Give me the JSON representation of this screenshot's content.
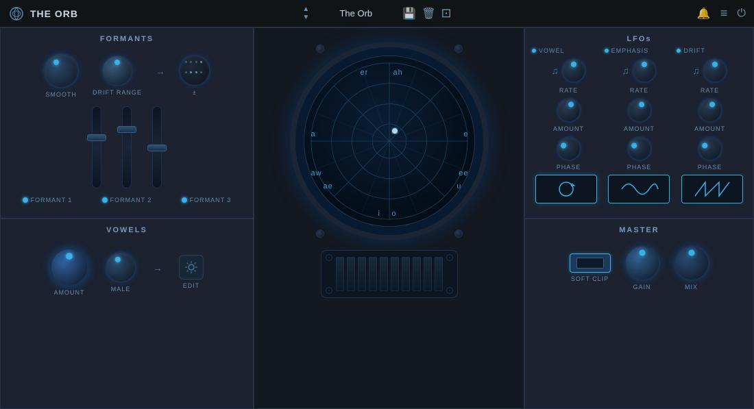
{
  "app": {
    "title": "THE ORB",
    "preset_name": "The Orb"
  },
  "toolbar": {
    "save_label": "💾",
    "delete_label": "🗑",
    "grid_label": "⊞",
    "bell_label": "🔔",
    "menu_label": "≡",
    "power_label": "⏻"
  },
  "formants": {
    "title": "FORMANTS",
    "smooth_label": "SMOOTH",
    "drift_range_label": "DRIFT RANGE",
    "pm_label": "±",
    "formant1_label": "FORMANT 1",
    "formant2_label": "FORMANT 2",
    "formant3_label": "FORMANT 3"
  },
  "vowels": {
    "title": "VOWELS",
    "amount_label": "AMOUNT",
    "male_label": "MALE",
    "edit_label": "EDIT"
  },
  "lfos": {
    "title": "LFOs",
    "vowel_label": "VOWEL",
    "emphasis_label": "EMPHASIS",
    "drift_label": "DRIFT",
    "rate_label": "RATE",
    "amount_label": "AMOUNT",
    "phase_label": "PHASE",
    "waveforms": [
      "circle",
      "sine",
      "sawtooth"
    ]
  },
  "master": {
    "title": "MASTER",
    "soft_clip_label": "SOFT CLIP",
    "gain_label": "GAIN",
    "mix_label": "MIX"
  },
  "orb": {
    "vowels": [
      "er",
      "ah",
      "e",
      "ee",
      "u",
      "o",
      "i",
      "ae",
      "aw",
      "a"
    ]
  }
}
